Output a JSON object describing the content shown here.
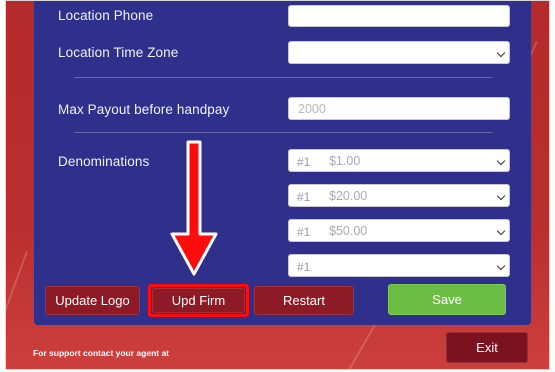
{
  "form": {
    "location_phone": {
      "label": "Location Phone",
      "value": ""
    },
    "location_time_zone": {
      "label": "Location Time Zone",
      "value": ""
    },
    "max_payout": {
      "label": "Max Payout before handpay",
      "placeholder": "2000"
    },
    "denominations": {
      "label": "Denominations",
      "items": [
        {
          "index": "#1",
          "amount": "$1.00"
        },
        {
          "index": "#1",
          "amount": "$20.00"
        },
        {
          "index": "#1",
          "amount": "$50.00"
        },
        {
          "index": "#1",
          "amount": ""
        }
      ]
    }
  },
  "buttons": {
    "update_logo": "Update Logo",
    "upd_firm": "Upd Firm",
    "restart": "Restart",
    "save": "Save",
    "exit": "Exit"
  },
  "footer": {
    "support_text": "For support contact your agent at"
  },
  "annotation": {
    "arrow_color": "#ff0d0d",
    "highlight_color": "#ff0d0d"
  },
  "colors": {
    "panel": "#2f2f8c",
    "background": "#b52a2c",
    "save_button": "#6cbd44",
    "dark_button": "#8d1a25"
  }
}
